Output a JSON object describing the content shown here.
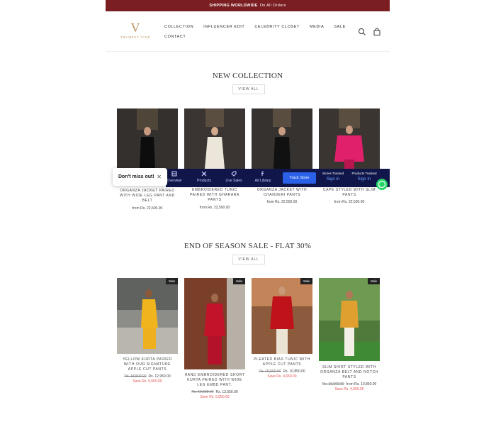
{
  "promo": {
    "bold": "SHIPPING WORLDWIDE",
    "text": "On All Orders"
  },
  "brand": {
    "mark": "V",
    "name": "TRUMPET VINE"
  },
  "nav": [
    "COLLECTION",
    "INFLUENCER EDIT",
    "CELEBRITY CLOSET",
    "MEDIA",
    "SALE",
    "CONTACT"
  ],
  "header_icons": [
    "search-icon",
    "cart-icon"
  ],
  "new_collection": {
    "title": "NEW COLLECTION",
    "view_all": "VIEW ALL",
    "products": [
      {
        "title": "ORGANZA JACKET PAIRED WITH WIDE LEG PANT AND BELT",
        "price": "from Rs. 22,500.00"
      },
      {
        "title": "EMBROIDERED TUNIC PAIRED WITH GHARARA PANTS",
        "price": "from Rs. 22,500.00"
      },
      {
        "title": "ORGANZA JACKET WITH CHANDERI PANTS",
        "price": "from Rs. 22,500.00"
      },
      {
        "title": "CAPE STYLED WITH SLIM PANTS",
        "price": "from Rs. 22,500.00"
      }
    ]
  },
  "sale": {
    "title": "END OF SEASON SALE - FLAT 30%",
    "view_all": "VIEW ALL",
    "badge": "Sale",
    "products": [
      {
        "title": "YELLOW KURTA PAIRED WITH OUR SIGNATURE APPLE CUT PANTS",
        "old_price": "Rs. 18,500.00",
        "price": "Rs. 12,950.00",
        "save": "Save Rs. 5,550.00"
      },
      {
        "title": "HAND EMBROIDERED SHORT KURTA PAIRED WITH WIDE LEG EMBD PANT.",
        "old_price": "Rs. 19,500.00",
        "price": "Rs. 13,650.00",
        "save": "Save Rs. 5,850.00"
      },
      {
        "title": "PLEATED BIAS TUNIC WITH APPLE CUT PANTS",
        "old_price": "Rs. 15,500.00",
        "price": "Rs. 10,850.00",
        "save": "Save Rs. 4,650.00"
      },
      {
        "title": "SLIM SHIRT STYLED WITH ORGANZA BELT AND NOTCH PANTS",
        "old_price": "Rs. 15,500.00",
        "price": "from Rs. 10,850.00",
        "save": "Save Rs. 4,650.00"
      }
    ]
  },
  "extension": {
    "toast": "Don't miss out!",
    "items": [
      "Overview",
      "Products",
      "Live Sales",
      "Ad Library"
    ],
    "track_button": "Track Store",
    "stats": [
      {
        "label": "Stores Tracked",
        "link": "Sign In"
      },
      {
        "label": "Products Tracked",
        "link": "Sign In"
      }
    ]
  },
  "colors": {
    "promo_bar": "#7a1e22",
    "brand": "#b8935a",
    "sale_text": "#e05555",
    "ext_bar": "#10164a",
    "ext_button": "#2a61e8",
    "whatsapp": "#25d366"
  }
}
